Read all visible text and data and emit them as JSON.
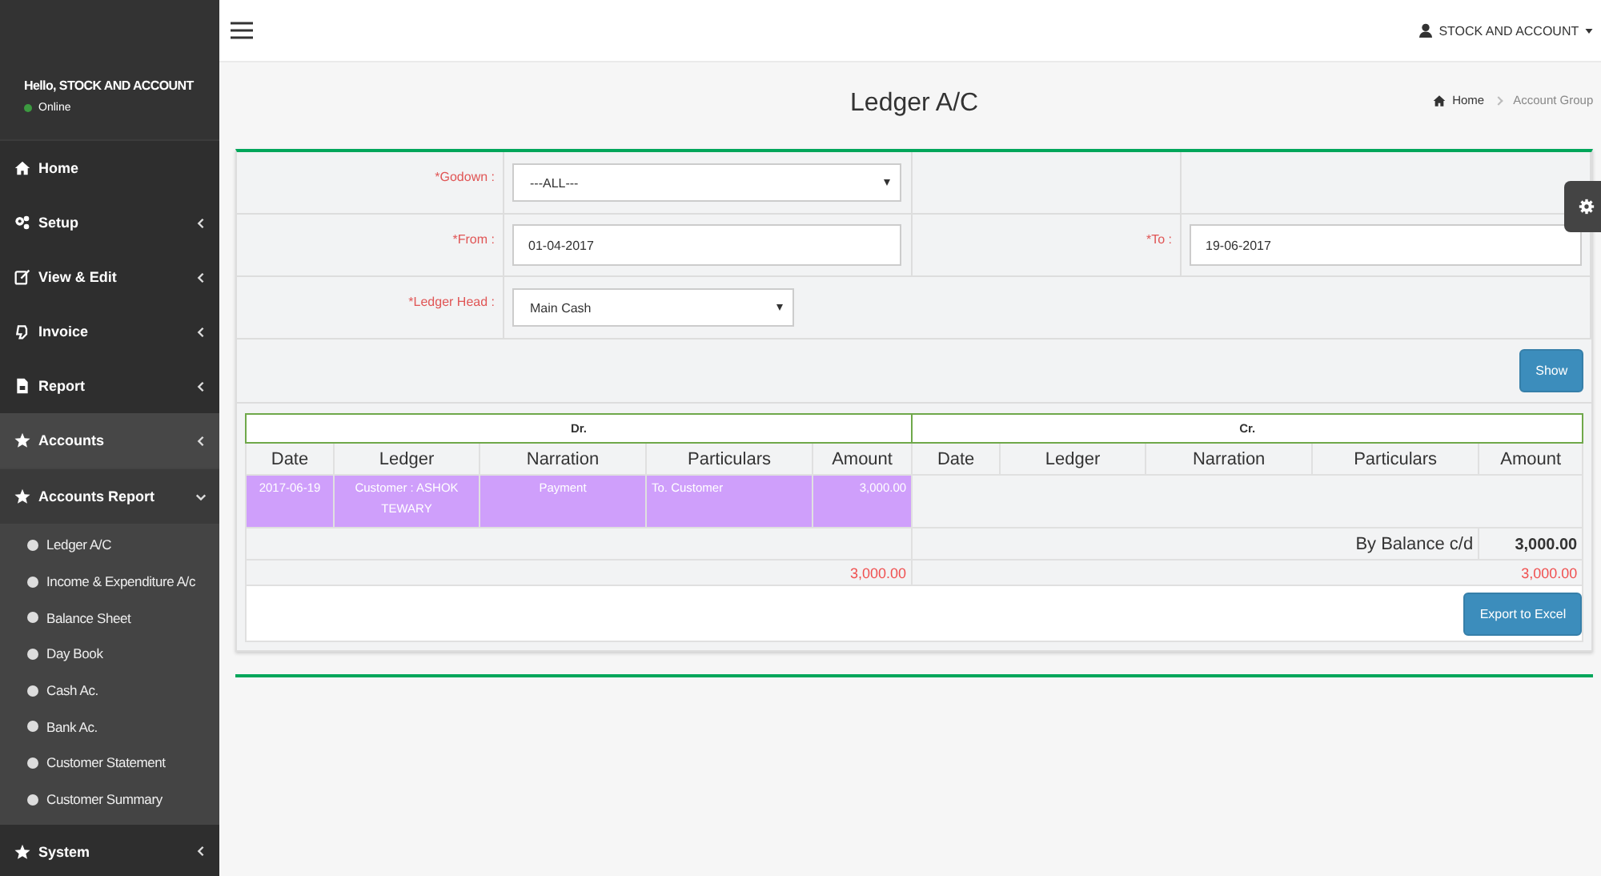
{
  "topbar": {
    "user": "STOCK AND ACCOUNT"
  },
  "sidebar": {
    "greeting": "Hello, STOCK AND ACCOUNT",
    "status": "Online",
    "items": [
      {
        "label": "Home",
        "kind": "link",
        "selected": false
      },
      {
        "label": "Setup",
        "kind": "menu",
        "expanded": false,
        "selected": false
      },
      {
        "label": "View & Edit",
        "kind": "menu",
        "expanded": false,
        "selected": false
      },
      {
        "label": "Invoice",
        "kind": "menu",
        "expanded": false,
        "selected": false
      },
      {
        "label": "Report",
        "kind": "menu",
        "expanded": false,
        "selected": false
      },
      {
        "label": "Accounts",
        "kind": "menu",
        "expanded": false,
        "selected": true
      },
      {
        "label": "Accounts Report",
        "kind": "menu",
        "expanded": true,
        "selected": false,
        "children": [
          {
            "label": "Ledger A/C"
          },
          {
            "label": "Income & Expenditure A/c"
          },
          {
            "label": "Balance Sheet"
          },
          {
            "label": "Day Book"
          },
          {
            "label": "Cash Ac."
          },
          {
            "label": "Bank Ac."
          },
          {
            "label": "Customer Statement"
          },
          {
            "label": "Customer Summary"
          }
        ]
      },
      {
        "label": "System",
        "kind": "menu",
        "expanded": false,
        "selected": false
      }
    ]
  },
  "page": {
    "title": "Ledger A/C",
    "breadcrumb": [
      "Home",
      "Account Group"
    ]
  },
  "form": {
    "godown": {
      "label": "*Godown :",
      "value": "---ALL---"
    },
    "from": {
      "label": "*From :",
      "value": "01-04-2017"
    },
    "to": {
      "label": "*To :",
      "value": "19-06-2017"
    },
    "ledger_head": {
      "label": "*Ledger Head :",
      "value": "Main Cash"
    },
    "show_button": "Show"
  },
  "report": {
    "dr_title": "Dr.",
    "cr_title": "Cr.",
    "dr_columns": [
      "Date",
      "Ledger",
      "Narration",
      "Particulars",
      "Amount"
    ],
    "cr_columns": [
      "Date",
      "Ledger",
      "Narration",
      "Particulars",
      "Amount"
    ],
    "dr_rows": [
      {
        "date": "2017-06-19",
        "ledger": "Customer : ASHOK TEWARY",
        "narration": "Payment",
        "particulars": "To. Customer",
        "amount": "3,000.00",
        "selected": true
      }
    ],
    "balance": {
      "label": "By Balance c/d",
      "amount": "3,000.00"
    },
    "totals": {
      "dr": "3,000.00",
      "cr": "3,000.00"
    },
    "export_button": "Export to Excel"
  }
}
